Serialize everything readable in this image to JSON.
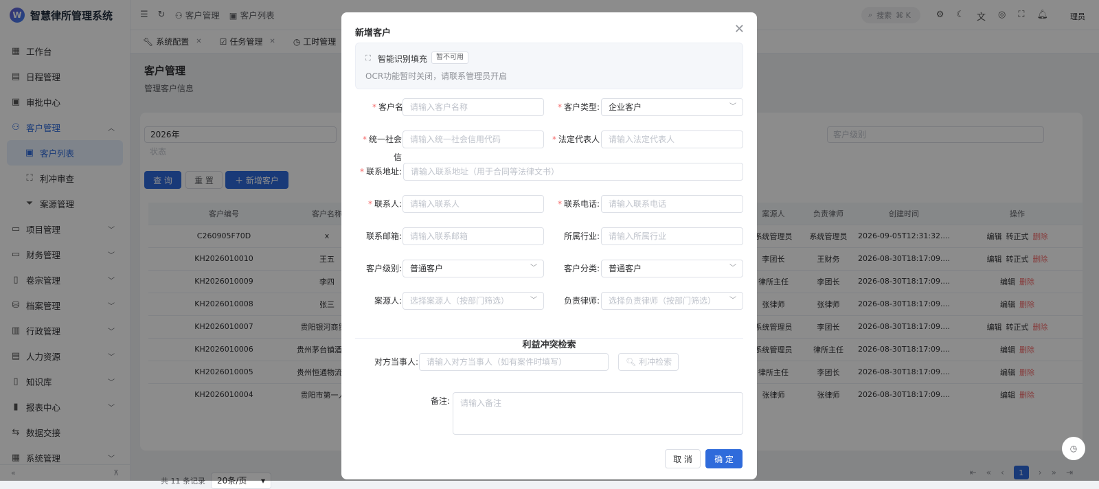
{
  "app": {
    "logo_text": "智慧律所管理系统",
    "logo_mark": "W"
  },
  "sidebar": {
    "items": [
      {
        "label": "工作台",
        "icon": "dashboard-icon"
      },
      {
        "label": "日程管理",
        "icon": "calendar-icon"
      },
      {
        "label": "审批中心",
        "icon": "approval-icon"
      },
      {
        "label": "客户管理",
        "icon": "users-icon"
      },
      {
        "label": "客户列表",
        "icon": "contact-card-icon"
      },
      {
        "label": "利冲审查",
        "icon": "scan-icon"
      },
      {
        "label": "案源管理",
        "icon": "filter-icon"
      },
      {
        "label": "项目管理",
        "icon": "folder-icon"
      },
      {
        "label": "财务管理",
        "icon": "wallet-icon"
      },
      {
        "label": "卷宗管理",
        "icon": "file-icon"
      },
      {
        "label": "档案管理",
        "icon": "database-icon"
      },
      {
        "label": "行政管理",
        "icon": "building-icon"
      },
      {
        "label": "人力资源",
        "icon": "id-card-icon"
      },
      {
        "label": "知识库",
        "icon": "book-icon"
      },
      {
        "label": "报表中心",
        "icon": "bar-chart-icon"
      },
      {
        "label": "数据交接",
        "icon": "transfer-icon"
      },
      {
        "label": "系统管理",
        "icon": "settings-icon"
      }
    ]
  },
  "topbar": {
    "breadcrumb": [
      "客户管理",
      "客户列表"
    ],
    "search_label": "搜索",
    "search_shortcut": "⌘ K",
    "user": "理员"
  },
  "tabs": [
    {
      "label": "系统配置"
    },
    {
      "label": "任务管理"
    },
    {
      "label": "工时管理"
    }
  ],
  "page": {
    "title": "客户管理",
    "subtitle": "管理客户信息"
  },
  "filters": {
    "year": "2026年",
    "status_placeholder": "状态",
    "level_placeholder": "客户级别",
    "query_button": "查 询",
    "reset_button": "重 置",
    "add_button": "新增客户"
  },
  "table": {
    "headers": [
      "客户编号",
      "客户名称",
      "案源人",
      "负责律师",
      "创建时间",
      "操作"
    ],
    "rows": [
      {
        "id": "C260905F70D",
        "name": "x",
        "source": "系统管理员",
        "lawyer": "系统管理员",
        "created": "2026-09-05T12:31:32....",
        "ops": [
          "编辑",
          "转正式",
          "删除"
        ]
      },
      {
        "id": "KH2026010010",
        "name": "王五",
        "source": "李团长",
        "lawyer": "王财务",
        "created": "2026-08-30T18:17:09....",
        "ops": [
          "编辑",
          "转正式",
          "删除"
        ]
      },
      {
        "id": "KH2026010009",
        "name": "李四",
        "source": "律所主任",
        "lawyer": "李团长",
        "created": "2026-08-30T18:17:09....",
        "ops": [
          "编辑",
          "删除"
        ]
      },
      {
        "id": "KH2026010008",
        "name": "张三",
        "source": "张律师",
        "lawyer": "张律师",
        "created": "2026-08-30T18:17:09....",
        "ops": [
          "编辑",
          "删除"
        ]
      },
      {
        "id": "KH2026010007",
        "name": "贵阳银河商贸有",
        "source": "系统管理员",
        "lawyer": "李团长",
        "created": "2026-08-30T18:17:09....",
        "ops": [
          "编辑",
          "转正式",
          "删除"
        ]
      },
      {
        "id": "KH2026010006",
        "name": "贵州茅台镇酒业有",
        "source": "系统管理员",
        "lawyer": "律所主任",
        "created": "2026-08-30T18:17:09....",
        "ops": [
          "编辑",
          "删除"
        ]
      },
      {
        "id": "KH2026010005",
        "name": "贵州恒通物流有自",
        "source": "律所主任",
        "lawyer": "李团长",
        "created": "2026-08-30T18:17:09....",
        "ops": [
          "编辑",
          "删除"
        ]
      },
      {
        "id": "KH2026010004",
        "name": "贵阳市第一人民",
        "source": "张律师",
        "lawyer": "张律师",
        "created": "2026-08-30T18:17:09....",
        "ops": [
          "编辑",
          "删除"
        ]
      }
    ]
  },
  "pager": {
    "total": "共 11 条记录",
    "page_size": "20条/页",
    "current": "1"
  },
  "modal": {
    "title": "新增客户",
    "ocr": {
      "title": "智能识别填充",
      "badge": "暂不可用",
      "desc": "OCR功能暂时关闭，请联系管理员开启"
    },
    "fields": {
      "name": {
        "label": "客户名称:",
        "placeholder": "请输入客户名称"
      },
      "type": {
        "label": "客户类型:",
        "value": "企业客户"
      },
      "credit_code": {
        "label": "统一社会信",
        "placeholder": "请输入统一社会信用代码"
      },
      "legal_rep": {
        "label": "法定代表人",
        "placeholder": "请输入法定代表人"
      },
      "address": {
        "label": "联系地址:",
        "placeholder": "请输入联系地址（用于合同等法律文书）"
      },
      "contact": {
        "label": "联系人:",
        "placeholder": "请输入联系人"
      },
      "phone": {
        "label": "联系电话:",
        "placeholder": "请输入联系电话"
      },
      "email": {
        "label": "联系邮箱:",
        "placeholder": "请输入联系邮箱"
      },
      "industry": {
        "label": "所属行业:",
        "placeholder": "请输入所属行业"
      },
      "level": {
        "label": "客户级别:",
        "value": "普通客户"
      },
      "category": {
        "label": "客户分类:",
        "value": "普通客户"
      },
      "source_person": {
        "label": "案源人:",
        "placeholder": "选择案源人（按部门筛选）"
      },
      "lawyer": {
        "label": "负责律师:",
        "placeholder": "选择负责律师（按部门筛选）"
      }
    },
    "conflict": {
      "section_title": "利益冲突检索",
      "party_label": "对方当事人:",
      "party_placeholder": "请输入对方当事人（如有案件时填写）",
      "check_button": "利冲检索"
    },
    "remark": {
      "label": "备注:",
      "placeholder": "请输入备注"
    },
    "cancel_button": "取 消",
    "confirm_button": "确 定"
  },
  "colors": {
    "primary": "#2f6bdb",
    "danger": "#f56c6c",
    "required": "#f56c6c"
  }
}
